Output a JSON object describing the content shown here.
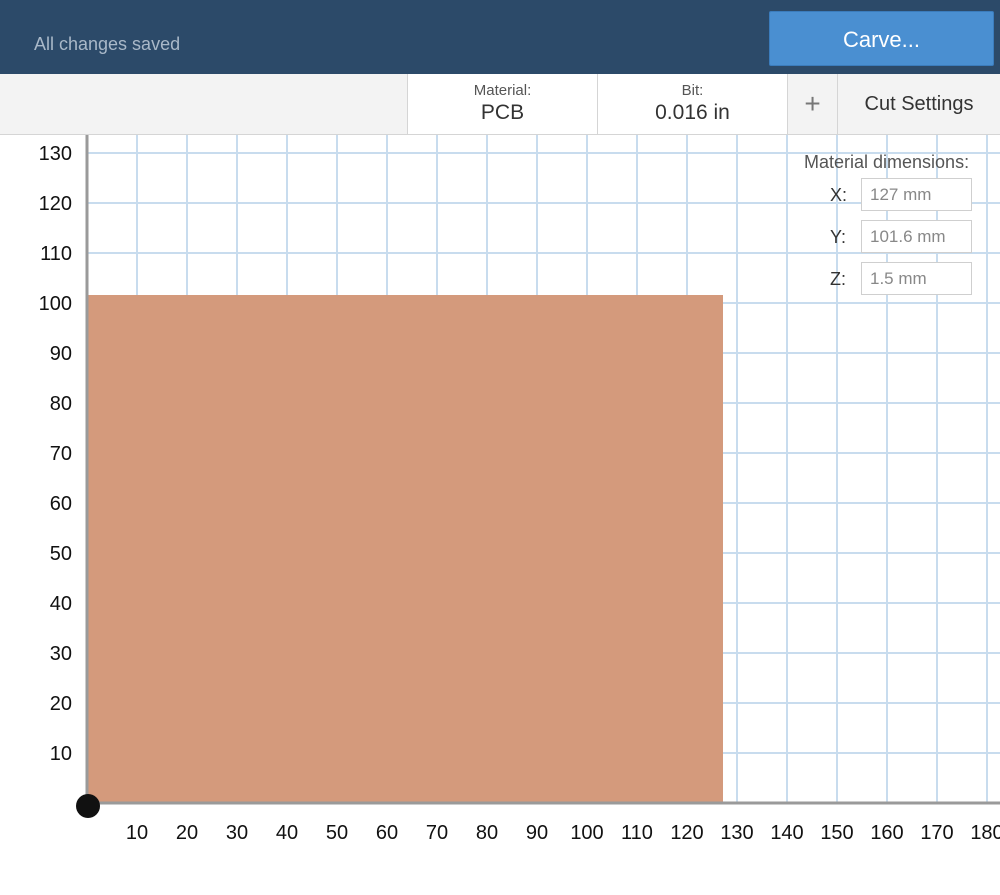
{
  "header": {
    "status": "All changes saved",
    "carve_label": "Carve..."
  },
  "toolbar": {
    "material_label": "Material:",
    "material_value": "PCB",
    "bit_label": "Bit:",
    "bit_value": "0.016 in",
    "add_label": "+",
    "cut_settings_label": "Cut Settings"
  },
  "material_dimensions": {
    "title": "Material dimensions:",
    "x_label": "X:",
    "x_value": "127 mm",
    "y_label": "Y:",
    "y_value": "101.6 mm",
    "z_label": "Z:",
    "z_value": "1.5 mm"
  },
  "workspace": {
    "x_ticks": [
      "10",
      "20",
      "30",
      "40",
      "50",
      "60",
      "70",
      "80",
      "90",
      "100",
      "110",
      "120",
      "130",
      "140",
      "150",
      "160",
      "170",
      "180"
    ],
    "y_ticks": [
      "10",
      "20",
      "30",
      "40",
      "50",
      "60",
      "70",
      "80",
      "90",
      "100",
      "110",
      "120",
      "130"
    ],
    "material_color": "#d49a7c",
    "grid_color": "#c8dcee"
  }
}
